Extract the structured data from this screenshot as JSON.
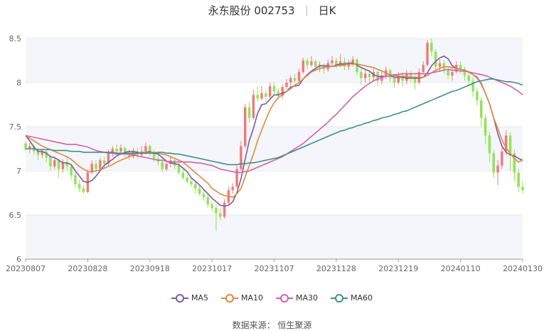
{
  "title": {
    "stock": "永东股份 002753",
    "period": "日K"
  },
  "source": "数据来源： 恒生聚源",
  "colors": {
    "up": "#f07b7b",
    "down": "#93e354",
    "MA5": "#7b5aa6",
    "MA10": "#e08a3c",
    "MA30": "#d55fae",
    "MA60": "#3f8f8c",
    "grid": "#e8e8e8",
    "band": "#f4f6fb"
  },
  "chart_data": {
    "type": "candlestick",
    "ylim": [
      6,
      8.5
    ],
    "yticks": [
      6,
      6.5,
      7,
      7.5,
      8,
      8.5
    ],
    "ytick_labels": [
      "6",
      "6.5",
      "7",
      "7.5",
      "8",
      "8.5"
    ],
    "xtick_labels": [
      "20230807",
      "20230828",
      "20230918",
      "20231017",
      "20231107",
      "20231128",
      "20231219",
      "20240110",
      "20240130"
    ],
    "n_days": 121,
    "xtick_index": [
      0,
      15,
      30,
      45,
      60,
      75,
      90,
      105,
      120
    ],
    "legend": [
      "MA5",
      "MA10",
      "MA30",
      "MA60"
    ],
    "candles": [
      [
        7.31,
        7.25,
        7.34,
        7.22
      ],
      [
        7.25,
        7.28,
        7.32,
        7.2
      ],
      [
        7.28,
        7.22,
        7.3,
        7.18
      ],
      [
        7.22,
        7.18,
        7.26,
        7.12
      ],
      [
        7.18,
        7.22,
        7.25,
        7.14
      ],
      [
        7.22,
        7.15,
        7.24,
        7.1
      ],
      [
        7.15,
        7.05,
        7.18,
        7.0
      ],
      [
        7.05,
        7.12,
        7.15,
        7.02
      ],
      [
        7.12,
        7.02,
        7.14,
        6.92
      ],
      [
        7.02,
        7.1,
        7.13,
        6.98
      ],
      [
        7.1,
        7.05,
        7.16,
        7.0
      ],
      [
        7.05,
        6.95,
        7.08,
        6.9
      ],
      [
        6.95,
        6.85,
        6.98,
        6.8
      ],
      [
        6.85,
        6.8,
        6.9,
        6.76
      ],
      [
        6.8,
        6.76,
        6.84,
        6.74
      ],
      [
        6.76,
        6.98,
        7.02,
        6.75
      ],
      [
        6.98,
        7.08,
        7.12,
        6.96
      ],
      [
        7.08,
        7.02,
        7.12,
        6.98
      ],
      [
        7.02,
        7.12,
        7.15,
        7.0
      ],
      [
        7.12,
        7.08,
        7.16,
        7.02
      ],
      [
        7.08,
        7.2,
        7.24,
        7.06
      ],
      [
        7.2,
        7.25,
        7.28,
        7.16
      ],
      [
        7.25,
        7.22,
        7.3,
        7.18
      ],
      [
        7.22,
        7.26,
        7.3,
        7.18
      ],
      [
        7.26,
        7.2,
        7.28,
        7.16
      ],
      [
        7.2,
        7.16,
        7.24,
        7.12
      ],
      [
        7.16,
        7.22,
        7.26,
        7.14
      ],
      [
        7.22,
        7.18,
        7.26,
        7.14
      ],
      [
        7.18,
        7.22,
        7.28,
        7.16
      ],
      [
        7.22,
        7.28,
        7.32,
        7.18
      ],
      [
        7.28,
        7.2,
        7.3,
        7.16
      ],
      [
        7.2,
        7.14,
        7.24,
        7.1
      ],
      [
        7.14,
        7.1,
        7.18,
        7.06
      ],
      [
        7.1,
        7.02,
        7.14,
        6.98
      ],
      [
        7.02,
        7.08,
        7.12,
        7.0
      ],
      [
        7.08,
        7.12,
        7.16,
        7.04
      ],
      [
        7.12,
        7.06,
        7.14,
        7.02
      ],
      [
        7.06,
        6.98,
        7.1,
        6.96
      ],
      [
        6.98,
        6.92,
        7.02,
        6.9
      ],
      [
        6.92,
        6.88,
        6.96,
        6.86
      ],
      [
        6.88,
        6.85,
        6.92,
        6.82
      ],
      [
        6.85,
        6.8,
        6.88,
        6.74
      ],
      [
        6.8,
        6.74,
        6.84,
        6.72
      ],
      [
        6.74,
        6.7,
        6.78,
        6.66
      ],
      [
        6.7,
        6.62,
        6.74,
        6.58
      ],
      [
        6.62,
        6.58,
        6.66,
        6.54
      ],
      [
        6.58,
        6.52,
        6.62,
        6.32
      ],
      [
        6.52,
        6.48,
        6.58,
        6.44
      ],
      [
        6.48,
        6.64,
        6.68,
        6.46
      ],
      [
        6.64,
        6.78,
        6.82,
        6.62
      ],
      [
        6.78,
        6.82,
        6.86,
        6.74
      ],
      [
        6.82,
        7.02,
        7.06,
        6.8
      ],
      [
        7.02,
        7.28,
        7.34,
        7.0
      ],
      [
        7.28,
        7.72,
        7.76,
        7.26
      ],
      [
        7.72,
        7.6,
        7.78,
        7.54
      ],
      [
        7.6,
        7.86,
        7.92,
        7.58
      ],
      [
        7.86,
        7.82,
        7.96,
        7.78
      ],
      [
        7.82,
        7.88,
        7.96,
        7.8
      ],
      [
        7.88,
        7.84,
        7.92,
        7.78
      ],
      [
        7.84,
        7.96,
        8.0,
        7.82
      ],
      [
        7.96,
        7.9,
        8.0,
        7.86
      ],
      [
        7.9,
        7.85,
        7.94,
        7.8
      ],
      [
        7.85,
        7.95,
        7.98,
        7.82
      ],
      [
        7.95,
        8.0,
        8.04,
        7.92
      ],
      [
        8.0,
        8.05,
        8.08,
        7.96
      ],
      [
        8.05,
        8.02,
        8.1,
        7.98
      ],
      [
        8.02,
        8.12,
        8.16,
        8.0
      ],
      [
        8.12,
        8.25,
        8.28,
        8.1
      ],
      [
        8.25,
        8.2,
        8.28,
        8.15
      ],
      [
        8.2,
        8.24,
        8.3,
        8.18
      ],
      [
        8.24,
        8.18,
        8.26,
        8.14
      ],
      [
        8.18,
        8.2,
        8.24,
        8.12
      ],
      [
        8.2,
        8.15,
        8.22,
        8.1
      ],
      [
        8.15,
        8.22,
        8.26,
        8.12
      ],
      [
        8.22,
        8.25,
        8.3,
        8.18
      ],
      [
        8.25,
        8.2,
        8.28,
        8.16
      ],
      [
        8.2,
        8.24,
        8.32,
        8.18
      ],
      [
        8.24,
        8.18,
        8.28,
        8.14
      ],
      [
        8.18,
        8.22,
        8.26,
        8.14
      ],
      [
        8.22,
        8.26,
        8.3,
        8.18
      ],
      [
        8.26,
        8.12,
        8.28,
        8.08
      ],
      [
        8.12,
        8.05,
        8.16,
        7.98
      ],
      [
        8.05,
        8.1,
        8.14,
        8.0
      ],
      [
        8.1,
        8.06,
        8.14,
        8.0
      ],
      [
        8.06,
        8.12,
        8.16,
        8.02
      ],
      [
        8.12,
        8.02,
        8.14,
        7.96
      ],
      [
        8.02,
        8.08,
        8.12,
        7.98
      ],
      [
        8.08,
        8.14,
        8.18,
        8.04
      ],
      [
        8.14,
        8.05,
        8.16,
        8.0
      ],
      [
        8.05,
        8.0,
        8.08,
        7.94
      ],
      [
        8.0,
        8.08,
        8.12,
        7.98
      ],
      [
        8.08,
        8.02,
        8.12,
        7.96
      ],
      [
        8.02,
        8.1,
        8.14,
        7.98
      ],
      [
        8.1,
        8.05,
        8.14,
        8.0
      ],
      [
        8.05,
        8.0,
        8.1,
        7.92
      ],
      [
        8.0,
        8.12,
        8.16,
        7.98
      ],
      [
        8.12,
        8.2,
        8.24,
        8.1
      ],
      [
        8.2,
        8.45,
        8.48,
        8.18
      ],
      [
        8.45,
        8.35,
        8.5,
        8.3
      ],
      [
        8.35,
        8.18,
        8.38,
        8.12
      ],
      [
        8.18,
        8.22,
        8.26,
        8.12
      ],
      [
        8.22,
        8.15,
        8.26,
        8.1
      ],
      [
        8.15,
        8.08,
        8.18,
        8.04
      ],
      [
        8.08,
        8.12,
        8.16,
        8.02
      ],
      [
        8.12,
        8.2,
        8.24,
        8.1
      ],
      [
        8.2,
        8.15,
        8.24,
        8.1
      ],
      [
        8.15,
        8.08,
        8.18,
        8.02
      ],
      [
        8.08,
        8.02,
        8.12,
        7.96
      ],
      [
        8.02,
        7.9,
        8.06,
        7.84
      ],
      [
        7.9,
        7.8,
        7.94,
        7.74
      ],
      [
        7.8,
        7.6,
        7.84,
        7.5
      ],
      [
        7.6,
        7.4,
        7.64,
        7.3
      ],
      [
        7.4,
        7.2,
        7.44,
        7.1
      ],
      [
        7.2,
        6.98,
        7.24,
        6.92
      ],
      [
        6.98,
        7.06,
        7.12,
        6.84
      ],
      [
        7.06,
        7.22,
        7.28,
        7.02
      ],
      [
        7.22,
        7.4,
        7.46,
        7.18
      ],
      [
        7.4,
        7.2,
        7.44,
        7.0
      ],
      [
        7.2,
        6.98,
        7.24,
        6.88
      ],
      [
        6.98,
        6.82,
        7.02,
        6.76
      ],
      [
        6.82,
        6.78,
        6.88,
        6.74
      ]
    ],
    "series": [
      {
        "name": "MA5",
        "values": [
          7.4,
          7.34,
          7.27,
          7.22,
          7.22,
          7.2,
          7.16,
          7.15,
          7.12,
          7.09,
          7.09,
          7.07,
          7,
          6.94,
          6.88,
          6.87,
          6.89,
          6.94,
          7,
          7.06,
          7.1,
          7.13,
          7.17,
          7.19,
          7.21,
          7.22,
          7.22,
          7.21,
          7.2,
          7.21,
          7.22,
          7.2,
          7.19,
          7.15,
          7.11,
          7.09,
          7.08,
          7.07,
          7.03,
          6.99,
          6.92,
          6.88,
          6.84,
          6.79,
          6.74,
          6.69,
          6.65,
          6.61,
          6.6,
          6.61,
          6.65,
          6.75,
          6.91,
          7.13,
          7.34,
          7.48,
          7.65,
          7.75,
          7.76,
          7.81,
          7.86,
          7.86,
          7.88,
          7.9,
          7.95,
          7.96,
          7.97,
          8.04,
          8.09,
          8.13,
          8.16,
          8.19,
          8.19,
          8.19,
          8.18,
          8.2,
          8.21,
          8.21,
          8.22,
          8.22,
          8.2,
          8.17,
          8.15,
          8.13,
          8.09,
          8.07,
          8.07,
          8.07,
          8.08,
          8.06,
          8.06,
          8.06,
          8.05,
          8.05,
          8.05,
          8.05,
          8.06,
          8.11,
          8.19,
          8.24,
          8.28,
          8.3,
          8.27,
          8.19,
          8.16,
          8.15,
          8.14,
          8.12,
          8.09,
          8.06,
          7.99,
          7.88,
          7.76,
          7.6,
          7.42,
          7.28,
          7.21,
          7.18,
          7.17,
          7.14,
          7.12
        ]
      },
      {
        "name": "MA10",
        "values": [
          7.4,
          7.37,
          7.34,
          7.31,
          7.28,
          7.26,
          7.24,
          7.22,
          7.2,
          7.18,
          7.16,
          7.13,
          7.09,
          7.05,
          7.02,
          6.99,
          6.99,
          7,
          7.01,
          7.03,
          7.05,
          7.07,
          7.1,
          7.12,
          7.14,
          7.16,
          7.18,
          7.2,
          7.21,
          7.21,
          7.21,
          7.21,
          7.2,
          7.19,
          7.18,
          7.16,
          7.14,
          7.12,
          7.1,
          7.06,
          7.02,
          6.98,
          6.94,
          6.9,
          6.86,
          6.8,
          6.77,
          6.74,
          6.72,
          6.71,
          6.7,
          6.74,
          6.8,
          6.93,
          7.06,
          7.19,
          7.34,
          7.46,
          7.58,
          7.69,
          7.77,
          7.83,
          7.86,
          7.9,
          7.93,
          7.97,
          8,
          8.04,
          8.08,
          8.12,
          8.14,
          8.16,
          8.17,
          8.18,
          8.18,
          8.19,
          8.19,
          8.2,
          8.21,
          8.21,
          8.21,
          8.2,
          8.19,
          8.18,
          8.17,
          8.15,
          8.13,
          8.11,
          8.09,
          8.08,
          8.07,
          8.07,
          8.07,
          8.06,
          8.06,
          8.06,
          8.06,
          8.08,
          8.11,
          8.14,
          8.16,
          8.18,
          8.18,
          8.17,
          8.16,
          8.15,
          8.14,
          8.12,
          8.09,
          8.05,
          7.98,
          7.88,
          7.76,
          7.6,
          7.48,
          7.35,
          7.26,
          7.2,
          7.14,
          7.1,
          7.12
        ]
      },
      {
        "name": "MA30",
        "values": [
          7.4,
          7.39,
          7.38,
          7.37,
          7.36,
          7.35,
          7.34,
          7.33,
          7.32,
          7.31,
          7.3,
          7.3,
          7.3,
          7.29,
          7.28,
          7.27,
          7.25,
          7.23,
          7.22,
          7.21,
          7.2,
          7.2,
          7.19,
          7.19,
          7.19,
          7.19,
          7.18,
          7.17,
          7.16,
          7.15,
          7.14,
          7.13,
          7.12,
          7.12,
          7.11,
          7.1,
          7.1,
          7.1,
          7.1,
          7.1,
          7.1,
          7.09,
          7.09,
          7.08,
          7.07,
          7.06,
          7.04,
          7.02,
          7.01,
          7,
          6.99,
          6.98,
          6.98,
          6.99,
          7,
          7.02,
          7.04,
          7.06,
          7.08,
          7.1,
          7.12,
          7.14,
          7.16,
          7.19,
          7.22,
          7.25,
          7.28,
          7.31,
          7.35,
          7.39,
          7.43,
          7.47,
          7.51,
          7.55,
          7.6,
          7.64,
          7.69,
          7.74,
          7.79,
          7.84,
          7.88,
          7.92,
          7.96,
          7.99,
          8.02,
          8.04,
          8.06,
          8.07,
          8.08,
          8.09,
          8.09,
          8.1,
          8.1,
          8.1,
          8.1,
          8.1,
          8.1,
          8.1,
          8.11,
          8.12,
          8.13,
          8.14,
          8.15,
          8.14,
          8.14,
          8.13,
          8.13,
          8.12,
          8.11,
          8.1,
          8.09,
          8.08,
          8.06,
          8.04,
          8.02,
          8,
          7.98,
          7.96,
          7.93,
          7.9,
          7.86
        ]
      },
      {
        "name": "MA60",
        "values": [
          7.25,
          7.25,
          7.25,
          7.24,
          7.24,
          7.24,
          7.24,
          7.23,
          7.23,
          7.23,
          7.23,
          7.22,
          7.22,
          7.22,
          7.21,
          7.21,
          7.21,
          7.21,
          7.21,
          7.21,
          7.21,
          7.21,
          7.2,
          7.2,
          7.2,
          7.2,
          7.2,
          7.2,
          7.2,
          7.2,
          7.2,
          7.2,
          7.21,
          7.21,
          7.2,
          7.2,
          7.19,
          7.19,
          7.18,
          7.17,
          7.16,
          7.15,
          7.14,
          7.13,
          7.12,
          7.11,
          7.1,
          7.09,
          7.08,
          7.07,
          7.07,
          7.07,
          7.08,
          7.08,
          7.09,
          7.09,
          7.1,
          7.11,
          7.12,
          7.13,
          7.14,
          7.15,
          7.17,
          7.19,
          7.21,
          7.23,
          7.25,
          7.27,
          7.29,
          7.31,
          7.33,
          7.35,
          7.37,
          7.39,
          7.41,
          7.43,
          7.45,
          7.46,
          7.48,
          7.49,
          7.51,
          7.52,
          7.54,
          7.55,
          7.57,
          7.58,
          7.6,
          7.61,
          7.62,
          7.64,
          7.65,
          7.67,
          7.68,
          7.7,
          7.72,
          7.74,
          7.76,
          7.78,
          7.8,
          7.82,
          7.84,
          7.86,
          7.88,
          7.9,
          7.91,
          7.93,
          7.95,
          7.97,
          7.99,
          8.01,
          8.02,
          8.03,
          8.04,
          8.04,
          8.03,
          8.02,
          8.01,
          8.01,
          8,
          7.99,
          7.97
        ]
      }
    ]
  }
}
